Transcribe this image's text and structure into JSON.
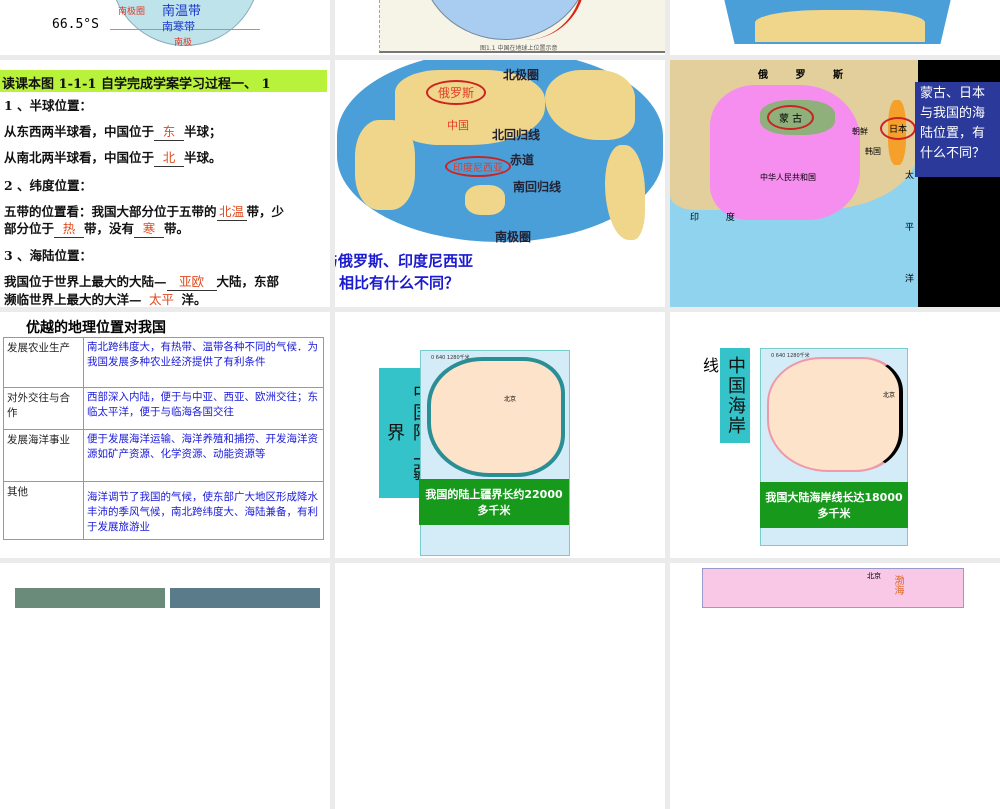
{
  "slide1": {
    "lat_label": "66.5°S",
    "polar_circle": "南极圈",
    "temperate": "南温带",
    "frigid": "南寒带",
    "pole": "南极"
  },
  "slide2": {
    "caption": "图1.1  中国在地球上位置示意"
  },
  "slide4": {
    "title": "读课本图 1-1-1   自学完成学案学习过程一、 1",
    "h1": "1 、半球位置：",
    "l1a": "从东西两半球看，中国位于",
    "a1": "东",
    "l1b": "半球；",
    "l2a": "从南北两半球看，中国位于",
    "a2": "北",
    "l2b": "半球。",
    "h2": "2 、纬度位置：",
    "l3a": "五带的位置看：我国大部分位于五带的",
    "a3": "北温",
    "l3b": "带，少",
    "l4a": "部分位于",
    "a4": "热",
    "l4b": "带，没有",
    "a5": "寒",
    "l4c": "带。",
    "h3": "3 、海陆位置：",
    "l5a": "我国位于世界上最大的大陆—",
    "a6": "亚欧",
    "l5b": "大陆，东部",
    "l6a": "濒临世界上最大的大洋—",
    "a7": "太平",
    "l6b": "洋。"
  },
  "slide5": {
    "arctic": "北极圈",
    "russia": "俄罗斯",
    "china": "中国",
    "tropic_n": "北回归线",
    "equator": "赤道",
    "indonesia": "印度尼西亚",
    "tropic_s": "南回归线",
    "antarctic": "南极圈",
    "q1": "与俄罗斯、印度尼西亚",
    "q2": "相比有什么不同？"
  },
  "slide6": {
    "russia": "俄 罗 斯",
    "mongolia": "蒙 古",
    "japan": "日本",
    "korea_n": "朝鲜",
    "korea_s": "韩国",
    "prc": "中华人民共和国",
    "india": "印 度",
    "pacific": "太 平 洋",
    "question": "蒙古、日本与我国的海陆位置，有什么不同？"
  },
  "slide7": {
    "title": "优越的地理位置对我国",
    "rows": [
      {
        "k": "发展农业生产",
        "v": "南北跨纬度大，有热带、温带各种不同的气候．为我国发展多种农业经济提供了有利条件"
      },
      {
        "k": "对外交往与合作",
        "v": "西部深入内陆，便于与中亚、西亚、欧洲交往；东临太平洋，便于与临海各国交往"
      },
      {
        "k": "发展海洋事业",
        "v": "便于发展海洋运输、海洋养殖和捕捞、开发海洋资源如矿产资源、化学资源、动能资源等"
      },
      {
        "k": "其他",
        "v": "海洋调节了我国的气候，使东部广大地区形成降水丰沛的季风气候，南北跨纬度大、海陆兼备，有利于发展旅游业"
      }
    ]
  },
  "slide8": {
    "vert": "中国陆上疆界",
    "scale": "0   640   1280千米",
    "beijing": "北京",
    "banner": "我国的陆上疆界长约22000多千米"
  },
  "slide9": {
    "pre": "线",
    "vert": "中国海岸",
    "scale": "0   640   1280千米",
    "beijing": "北京",
    "banner": "我国大陆海岸线长达18000多千米"
  },
  "slide12": {
    "beijing": "北京",
    "bohai": "渤海"
  }
}
